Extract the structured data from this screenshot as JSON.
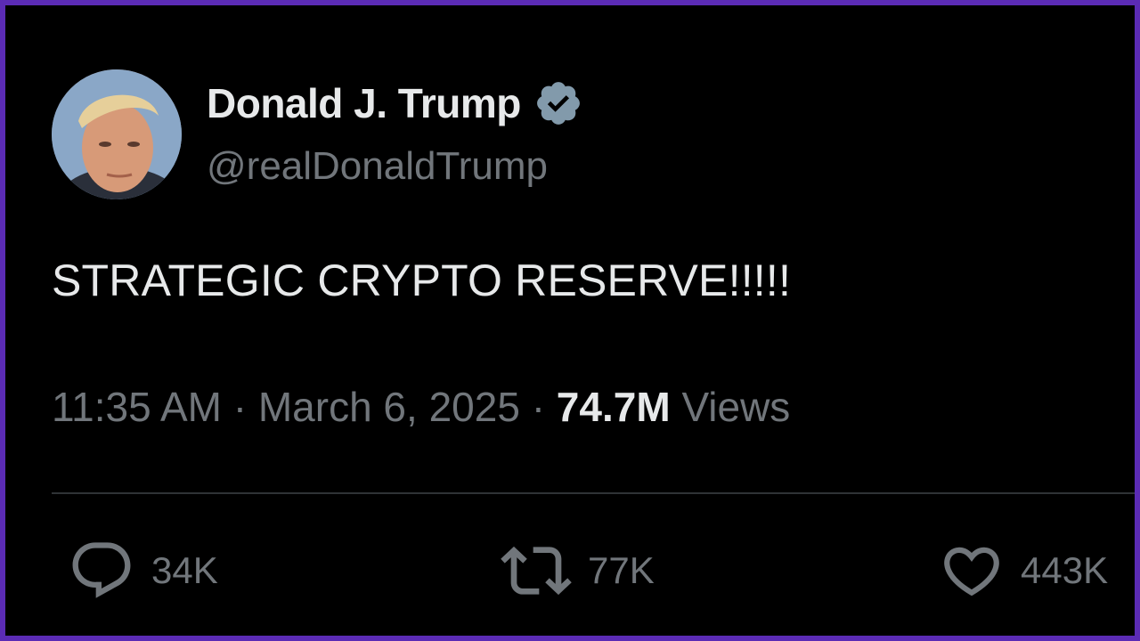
{
  "tweet": {
    "author_name": "Donald J. Trump",
    "handle": "@realDonaldTrump",
    "verified_icon": "verified-badge-icon",
    "text": "STRATEGIC CRYPTO RESERVE!!!!!",
    "time": "11:35 AM",
    "separator": "·",
    "date": "March 6, 2025",
    "views_count": "74.7M",
    "views_label": "Views"
  },
  "actions": {
    "reply": {
      "icon": "reply-icon",
      "count": "34K"
    },
    "repost": {
      "icon": "repost-icon",
      "count": "77K"
    },
    "like": {
      "icon": "heart-icon",
      "count": "443K"
    }
  },
  "colors": {
    "background": "#000000",
    "frame_border": "#5b2bb5",
    "primary_text": "#e7e9ea",
    "secondary_text": "#71767b",
    "verified_badge": "#829aab",
    "divider": "#2f3336"
  }
}
